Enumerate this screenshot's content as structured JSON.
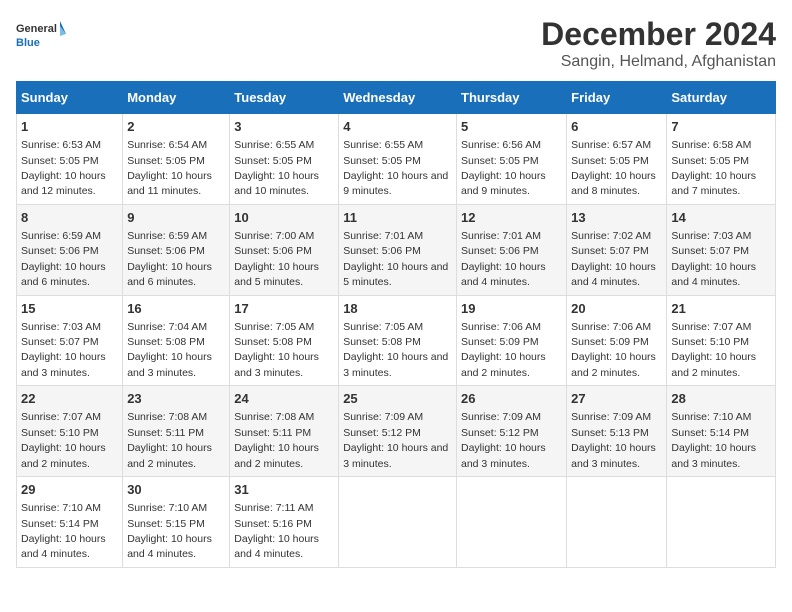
{
  "logo": {
    "general": "General",
    "blue": "Blue"
  },
  "title": "December 2024",
  "subtitle": "Sangin, Helmand, Afghanistan",
  "days_of_week": [
    "Sunday",
    "Monday",
    "Tuesday",
    "Wednesday",
    "Thursday",
    "Friday",
    "Saturday"
  ],
  "weeks": [
    [
      {
        "day": "1",
        "sunrise": "6:53 AM",
        "sunset": "5:05 PM",
        "daylight": "10 hours and 12 minutes."
      },
      {
        "day": "2",
        "sunrise": "6:54 AM",
        "sunset": "5:05 PM",
        "daylight": "10 hours and 11 minutes."
      },
      {
        "day": "3",
        "sunrise": "6:55 AM",
        "sunset": "5:05 PM",
        "daylight": "10 hours and 10 minutes."
      },
      {
        "day": "4",
        "sunrise": "6:55 AM",
        "sunset": "5:05 PM",
        "daylight": "10 hours and 9 minutes."
      },
      {
        "day": "5",
        "sunrise": "6:56 AM",
        "sunset": "5:05 PM",
        "daylight": "10 hours and 9 minutes."
      },
      {
        "day": "6",
        "sunrise": "6:57 AM",
        "sunset": "5:05 PM",
        "daylight": "10 hours and 8 minutes."
      },
      {
        "day": "7",
        "sunrise": "6:58 AM",
        "sunset": "5:05 PM",
        "daylight": "10 hours and 7 minutes."
      }
    ],
    [
      {
        "day": "8",
        "sunrise": "6:59 AM",
        "sunset": "5:06 PM",
        "daylight": "10 hours and 6 minutes."
      },
      {
        "day": "9",
        "sunrise": "6:59 AM",
        "sunset": "5:06 PM",
        "daylight": "10 hours and 6 minutes."
      },
      {
        "day": "10",
        "sunrise": "7:00 AM",
        "sunset": "5:06 PM",
        "daylight": "10 hours and 5 minutes."
      },
      {
        "day": "11",
        "sunrise": "7:01 AM",
        "sunset": "5:06 PM",
        "daylight": "10 hours and 5 minutes."
      },
      {
        "day": "12",
        "sunrise": "7:01 AM",
        "sunset": "5:06 PM",
        "daylight": "10 hours and 4 minutes."
      },
      {
        "day": "13",
        "sunrise": "7:02 AM",
        "sunset": "5:07 PM",
        "daylight": "10 hours and 4 minutes."
      },
      {
        "day": "14",
        "sunrise": "7:03 AM",
        "sunset": "5:07 PM",
        "daylight": "10 hours and 4 minutes."
      }
    ],
    [
      {
        "day": "15",
        "sunrise": "7:03 AM",
        "sunset": "5:07 PM",
        "daylight": "10 hours and 3 minutes."
      },
      {
        "day": "16",
        "sunrise": "7:04 AM",
        "sunset": "5:08 PM",
        "daylight": "10 hours and 3 minutes."
      },
      {
        "day": "17",
        "sunrise": "7:05 AM",
        "sunset": "5:08 PM",
        "daylight": "10 hours and 3 minutes."
      },
      {
        "day": "18",
        "sunrise": "7:05 AM",
        "sunset": "5:08 PM",
        "daylight": "10 hours and 3 minutes."
      },
      {
        "day": "19",
        "sunrise": "7:06 AM",
        "sunset": "5:09 PM",
        "daylight": "10 hours and 2 minutes."
      },
      {
        "day": "20",
        "sunrise": "7:06 AM",
        "sunset": "5:09 PM",
        "daylight": "10 hours and 2 minutes."
      },
      {
        "day": "21",
        "sunrise": "7:07 AM",
        "sunset": "5:10 PM",
        "daylight": "10 hours and 2 minutes."
      }
    ],
    [
      {
        "day": "22",
        "sunrise": "7:07 AM",
        "sunset": "5:10 PM",
        "daylight": "10 hours and 2 minutes."
      },
      {
        "day": "23",
        "sunrise": "7:08 AM",
        "sunset": "5:11 PM",
        "daylight": "10 hours and 2 minutes."
      },
      {
        "day": "24",
        "sunrise": "7:08 AM",
        "sunset": "5:11 PM",
        "daylight": "10 hours and 2 minutes."
      },
      {
        "day": "25",
        "sunrise": "7:09 AM",
        "sunset": "5:12 PM",
        "daylight": "10 hours and 3 minutes."
      },
      {
        "day": "26",
        "sunrise": "7:09 AM",
        "sunset": "5:12 PM",
        "daylight": "10 hours and 3 minutes."
      },
      {
        "day": "27",
        "sunrise": "7:09 AM",
        "sunset": "5:13 PM",
        "daylight": "10 hours and 3 minutes."
      },
      {
        "day": "28",
        "sunrise": "7:10 AM",
        "sunset": "5:14 PM",
        "daylight": "10 hours and 3 minutes."
      }
    ],
    [
      {
        "day": "29",
        "sunrise": "7:10 AM",
        "sunset": "5:14 PM",
        "daylight": "10 hours and 4 minutes."
      },
      {
        "day": "30",
        "sunrise": "7:10 AM",
        "sunset": "5:15 PM",
        "daylight": "10 hours and 4 minutes."
      },
      {
        "day": "31",
        "sunrise": "7:11 AM",
        "sunset": "5:16 PM",
        "daylight": "10 hours and 4 minutes."
      },
      null,
      null,
      null,
      null
    ]
  ],
  "labels": {
    "sunrise": "Sunrise:",
    "sunset": "Sunset:",
    "daylight": "Daylight:"
  }
}
